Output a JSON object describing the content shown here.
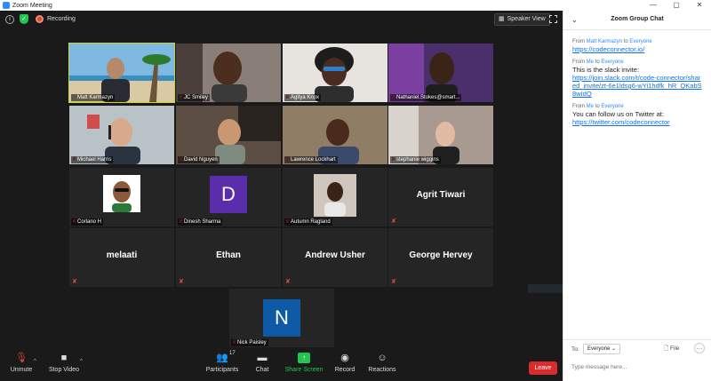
{
  "window": {
    "title": "Zoom Meeting",
    "controls": [
      "—",
      "▢",
      "✕"
    ]
  },
  "topbar": {
    "recording_label": "Recording",
    "view_label": "Speaker View"
  },
  "participants": [
    {
      "name": "Matt Karmazyn",
      "active": true,
      "type": "video",
      "muted": false
    },
    {
      "name": "JC Smiley",
      "type": "video",
      "muted": true
    },
    {
      "name": "Agitya Knox",
      "type": "video",
      "muted": true
    },
    {
      "name": "Nathaniel.Stokes@smart...",
      "type": "video",
      "muted": true
    },
    {
      "name": "Michael Harris",
      "type": "video",
      "muted": true
    },
    {
      "name": "David Nguyen",
      "type": "video",
      "muted": true
    },
    {
      "name": "Lawrence Lockhart",
      "type": "video",
      "muted": true
    },
    {
      "name": "stephanie wiggins",
      "type": "video",
      "muted": true
    },
    {
      "name": "Corlano H",
      "type": "photo",
      "muted": true
    },
    {
      "name": "Dinesh Sharma",
      "type": "letter",
      "letter": "D",
      "muted": true
    },
    {
      "name": "Autumn Ragland",
      "type": "photo",
      "muted": true
    },
    {
      "name": "Agrit Tiwari",
      "type": "name",
      "muted": true
    },
    {
      "name": "melaati",
      "type": "name",
      "muted": true
    },
    {
      "name": "Ethan",
      "type": "name",
      "muted": true
    },
    {
      "name": "Andrew Usher",
      "type": "name",
      "muted": true
    },
    {
      "name": "George Hervey",
      "type": "name",
      "muted": true
    },
    {
      "name": "Nick Paisley",
      "type": "letter",
      "letter": "N",
      "muted": true
    }
  ],
  "toolbar": {
    "unmute": "Unmute",
    "stop_video": "Stop Video",
    "participants": "Participants",
    "participants_count": "17",
    "chat": "Chat",
    "share_screen": "Share Screen",
    "record": "Record",
    "reactions": "Reactions",
    "leave": "Leave"
  },
  "chat": {
    "title": "Zoom Group Chat",
    "messages": [
      {
        "from_prefix": "From",
        "from": "Matt Karmazyn",
        "to_prefix": "to",
        "to": "Everyone",
        "lines": [
          {
            "text": "https://codeconnector.io/",
            "link": true
          }
        ]
      },
      {
        "from_prefix": "From",
        "from": "Me",
        "to_prefix": "to",
        "to": "Everyone",
        "lines": [
          {
            "text": "This is the slack invite:",
            "link": false
          },
          {
            "text": "https://join.slack.com/t/code-connector/shared_invite/zt-6e1ldsg6-wYi1hdfk_hR_QKabS8wIdQ",
            "link": true
          }
        ]
      },
      {
        "from_prefix": "From",
        "from": "Me",
        "to_prefix": "to",
        "to": "Everyone",
        "lines": [
          {
            "text": "You can follow us on Twitter at:",
            "link": false
          },
          {
            "text": "https://twitter.com/codeconnector",
            "link": true
          }
        ]
      }
    ],
    "to_label": "To:",
    "recipient": "Everyone",
    "file_label": "File",
    "input_placeholder": "Type message here..."
  },
  "colors": {
    "active_border": "#c8d62b",
    "leave": "#d92d2d",
    "share": "#23c552",
    "link": "#0e71eb",
    "avatar_letter_bg": "#5b2dab",
    "avatar_n_bg": "#0e5aa7"
  }
}
